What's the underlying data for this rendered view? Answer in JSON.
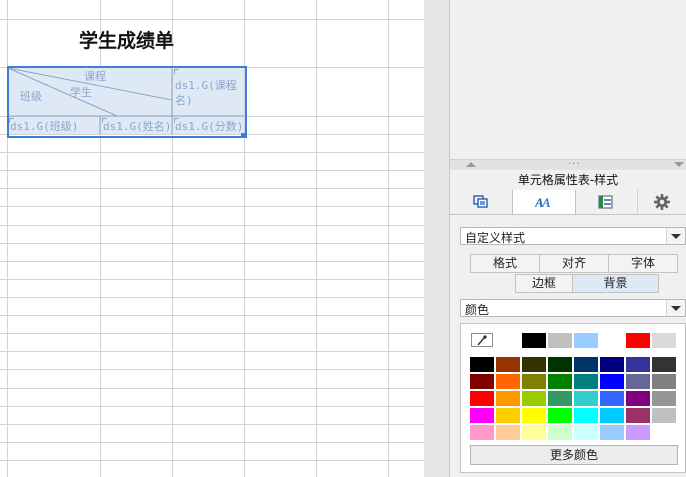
{
  "sheet": {
    "title": "学生成绩单",
    "diag_labels": {
      "course": "课程",
      "student": "学生",
      "class": "班级"
    },
    "cells": {
      "course_field": "ds1.G(课程名)",
      "class_field": "ds1.G(班级)",
      "name_field": "ds1.G(姓名)",
      "score_field": "ds1.G(分数)"
    },
    "colors": {
      "header_fill": "#dfe9f6",
      "selection": "#3b7fd9",
      "cell_text": "#8aa6c8"
    }
  },
  "panel": {
    "title": "单元格属性表-样式",
    "tabs": [
      {
        "icon": "cell-props-icon"
      },
      {
        "icon": "style-icon",
        "active": true
      },
      {
        "icon": "expand-icon"
      },
      {
        "icon": "gear-icon"
      }
    ],
    "style_select": "自定义样式",
    "subtabs_row1": [
      "格式",
      "对齐",
      "字体"
    ],
    "subtabs_row2": [
      "边框",
      "背景"
    ],
    "active_subtab": "背景",
    "fill_select": "颜色",
    "recent_colors": [
      "#000000",
      "#c0c0c0",
      "#99ccff",
      "#ffffff",
      "#ff0000",
      "#d9d9d9"
    ],
    "palette": [
      [
        "#000000",
        "#993300",
        "#333300",
        "#003300",
        "#003366",
        "#000080",
        "#333399",
        "#333333"
      ],
      [
        "#800000",
        "#ff6600",
        "#808000",
        "#008000",
        "#008080",
        "#0000ff",
        "#666699",
        "#808080"
      ],
      [
        "#ff0000",
        "#ff9900",
        "#99cc00",
        "#339966",
        "#33cccc",
        "#3366ff",
        "#800080",
        "#969696"
      ],
      [
        "#ff00ff",
        "#ffcc00",
        "#ffff00",
        "#00ff00",
        "#00ffff",
        "#00ccff",
        "#993366",
        "#c0c0c0"
      ],
      [
        "#ff99cc",
        "#ffcc99",
        "#ffff99",
        "#ccffcc",
        "#ccffff",
        "#99ccff",
        "#cc99ff",
        "#ffffff"
      ]
    ],
    "more_colors": "更多颜色"
  }
}
